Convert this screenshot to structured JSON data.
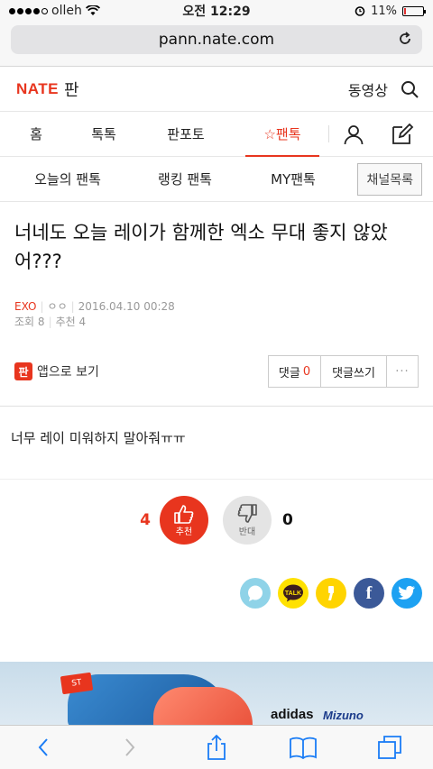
{
  "status_bar": {
    "carrier": "olleh",
    "time": "오전 12:29",
    "battery": "11%",
    "battery_level": 0.11
  },
  "browser": {
    "url": "pann.nate.com"
  },
  "header": {
    "logo_brand": "NATE",
    "logo_service": "판",
    "video_label": "동영상"
  },
  "main_nav": {
    "tabs": [
      "홈",
      "톡톡",
      "판포토",
      "☆팬톡"
    ],
    "active": "☆팬톡"
  },
  "sub_nav": {
    "items": [
      "오늘의 팬톡",
      "랭킹 팬톡",
      "MY팬톡"
    ],
    "channel_button": "채널목록"
  },
  "article": {
    "title": "너네도 오늘 레이가 함께한 엑소 무대 좋지 않았어???",
    "category": "EXO",
    "author": "ㅇㅇ",
    "date": "2016.04.10 00:28",
    "views_label": "조회",
    "views": "8",
    "recommend_label": "추천",
    "recommend": "4",
    "body": "너무 레이 미워하지 말아줘ㅠㅠ"
  },
  "actions": {
    "app_icon": "판",
    "app_view": "앱으로 보기",
    "comment_label": "댓글",
    "comment_count": "0",
    "write_comment": "댓글쓰기",
    "more": "···"
  },
  "vote": {
    "up_count": "4",
    "up_label": "추천",
    "down_count": "0",
    "down_label": "반대"
  },
  "share": {
    "kakao_label": "TALK",
    "facebook_label": "f"
  },
  "ad": {
    "tag": "ST",
    "brand1": "adidas",
    "brand2": "Mizuno"
  },
  "colors": {
    "accent": "#e8351e"
  }
}
